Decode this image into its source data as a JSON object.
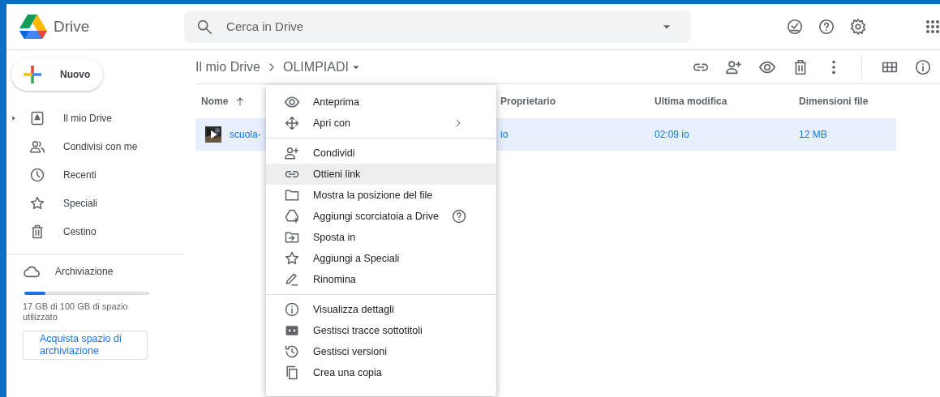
{
  "app": {
    "name": "Drive"
  },
  "search": {
    "placeholder": "Cerca in Drive"
  },
  "new_button": {
    "label": "Nuovo"
  },
  "sidebar": {
    "items": [
      {
        "label": "Il mio Drive",
        "expandable": true,
        "selected": false
      },
      {
        "label": "Condivisi con me",
        "expandable": false,
        "selected": false
      },
      {
        "label": "Recenti",
        "expandable": false,
        "selected": false
      },
      {
        "label": "Speciali",
        "expandable": false,
        "selected": false
      },
      {
        "label": "Cestino",
        "expandable": false,
        "selected": false
      }
    ]
  },
  "storage": {
    "label": "Archiviazione",
    "level": 0.17,
    "usage": "17 GB di 100 GB di spazio utilizzato",
    "button": "Acquista spazio di archiviazione"
  },
  "breadcrumb": [
    "Il mio Drive",
    "OLIMPIADI"
  ],
  "table": {
    "columns": [
      {
        "label": "Nome",
        "sorted": true
      },
      {
        "label": "Proprietario",
        "sorted": false
      },
      {
        "label": "Ultima modifica",
        "sorted": false
      },
      {
        "label": "Dimensioni file",
        "sorted": false
      }
    ],
    "rows": [
      {
        "name": "scuola-",
        "owner": "io",
        "modified": "02:09",
        "modified_by": "io",
        "size": "12 MB",
        "selected": true
      }
    ]
  },
  "context_menu": {
    "items": [
      {
        "kind": "item",
        "label": "Anteprima",
        "highlighted": false,
        "submenu": false,
        "help_icon": false
      },
      {
        "kind": "item",
        "label": "Apri con",
        "highlighted": false,
        "submenu": true,
        "help_icon": false
      },
      {
        "kind": "separator"
      },
      {
        "kind": "item",
        "label": "Condividi",
        "highlighted": false,
        "submenu": false,
        "help_icon": false
      },
      {
        "kind": "item",
        "label": "Ottieni link",
        "highlighted": true,
        "submenu": false,
        "help_icon": false
      },
      {
        "kind": "item",
        "label": "Mostra la posizione del file",
        "highlighted": false,
        "submenu": false,
        "help_icon": false
      },
      {
        "kind": "item",
        "label": "Aggiungi scorciatoia a Drive",
        "highlighted": false,
        "submenu": false,
        "help_icon": true
      },
      {
        "kind": "item",
        "label": "Sposta in",
        "highlighted": false,
        "submenu": false,
        "help_icon": false
      },
      {
        "kind": "item",
        "label": "Aggiungi a Speciali",
        "highlighted": false,
        "submenu": false,
        "help_icon": false
      },
      {
        "kind": "item",
        "label": "Rinomina",
        "highlighted": false,
        "submenu": false,
        "help_icon": false
      },
      {
        "kind": "separator"
      },
      {
        "kind": "item",
        "label": "Visualizza dettagli",
        "highlighted": false,
        "submenu": false,
        "help_icon": false
      },
      {
        "kind": "item",
        "label": "Gestisci tracce sottotitoli",
        "highlighted": false,
        "submenu": false,
        "help_icon": false
      },
      {
        "kind": "item",
        "label": "Gestisci versioni",
        "highlighted": false,
        "submenu": false,
        "help_icon": false
      },
      {
        "kind": "item",
        "label": "Crea una copia",
        "highlighted": false,
        "submenu": false,
        "help_icon": false
      }
    ]
  }
}
